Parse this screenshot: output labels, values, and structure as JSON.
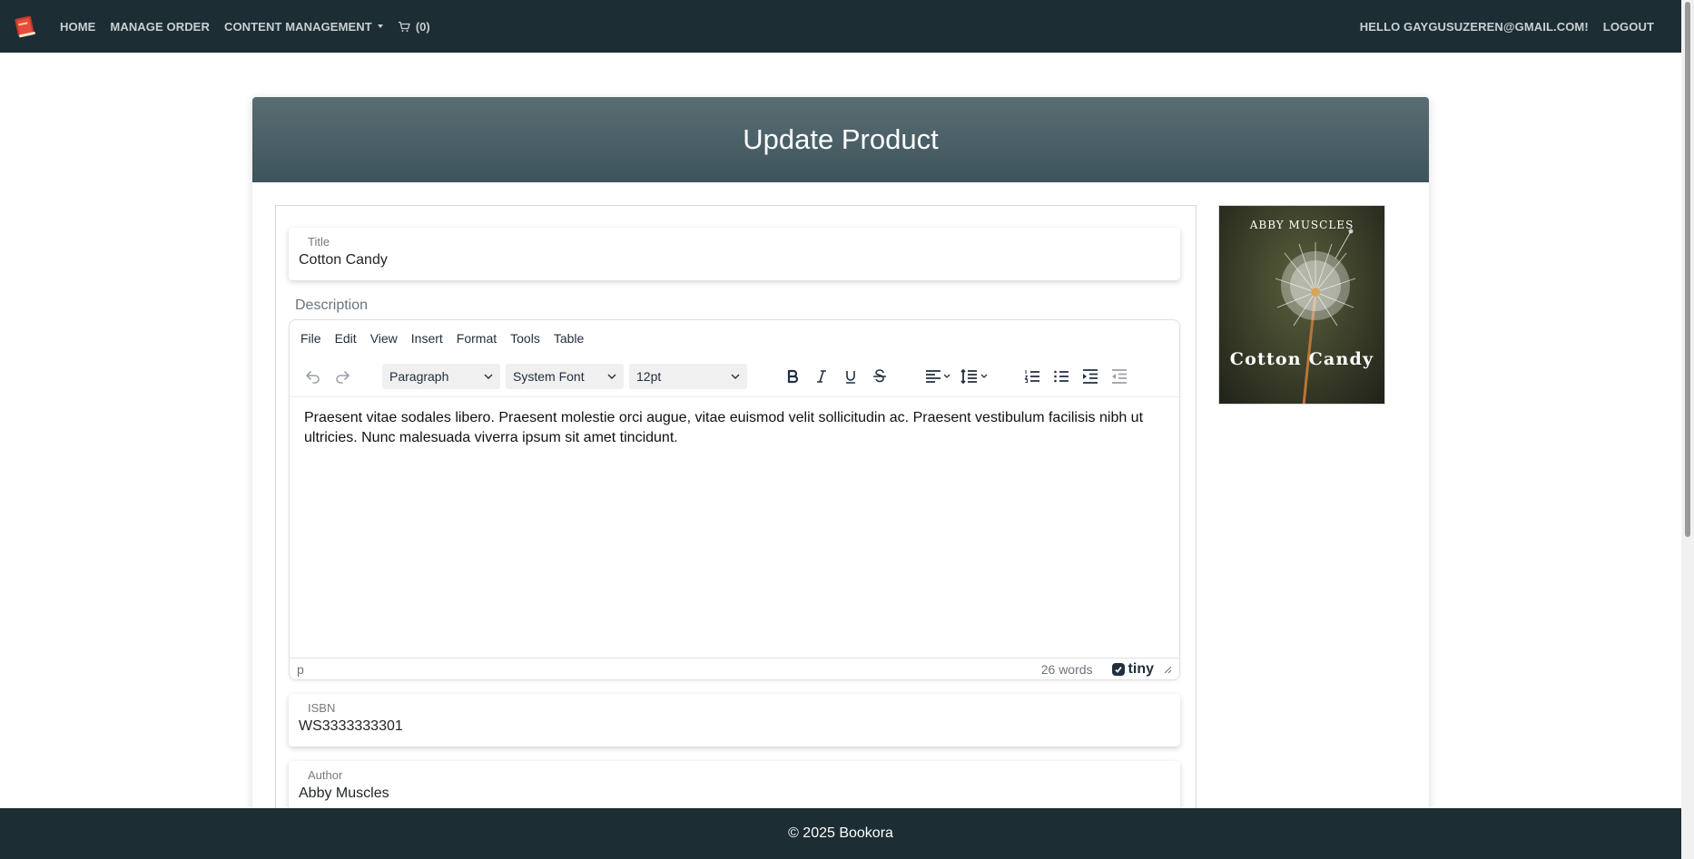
{
  "nav": {
    "links": [
      "HOME",
      "MANAGE ORDER",
      "CONTENT MANAGEMENT"
    ],
    "cart_count": "(0)",
    "greeting": "HELLO GAYGUSUZEREN@GMAIL.COM!",
    "logout": "LOGOUT"
  },
  "page": {
    "title": "Update Product"
  },
  "form": {
    "title_label": "Title",
    "title_value": "Cotton Candy",
    "description_label": "Description",
    "isbn_label": "ISBN",
    "isbn_value": "WS3333333301",
    "author_label": "Author",
    "author_value": "Abby Muscles"
  },
  "editor": {
    "menu": [
      "File",
      "Edit",
      "View",
      "Insert",
      "Format",
      "Tools",
      "Table"
    ],
    "block_format": "Paragraph",
    "font_family": "System Font",
    "font_size": "12pt",
    "content": "Praesent vitae sodales libero. Praesent molestie orci augue, vitae euismod velit sollicitudin ac. Praesent vestibulum facilisis nibh ut ultricies. Nunc malesuada viverra ipsum sit amet tincidunt.",
    "path": "p",
    "word_count": "26 words",
    "brand": "tiny"
  },
  "cover": {
    "author": "ABBY MUSCLES",
    "title": "Cotton Candy"
  },
  "footer": {
    "text": "© 2025 Bookora"
  },
  "colors": {
    "navbar": "#1c2d33",
    "header": "#4a5f66",
    "footer": "#1c2d33"
  }
}
